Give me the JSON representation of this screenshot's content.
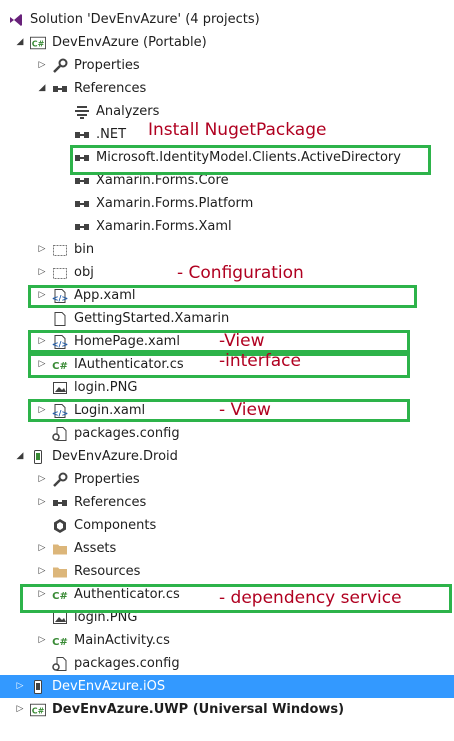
{
  "tree": {
    "items": [
      {
        "label": "Solution 'DevEnvAzure' (4 projects)",
        "icon": "vs-solution-icon",
        "arrow": ""
      },
      {
        "label": "DevEnvAzure (Portable)",
        "icon": "csharp-project-icon",
        "arrow": "expanded"
      },
      {
        "label": "Properties",
        "icon": "wrench-icon",
        "arrow": "collapsed"
      },
      {
        "label": "References",
        "icon": "references-icon",
        "arrow": "expanded"
      },
      {
        "label": "Analyzers",
        "icon": "analyzers-icon",
        "arrow": ""
      },
      {
        "label": ".NET",
        "icon": "reference-icon",
        "arrow": ""
      },
      {
        "label": "Microsoft.IdentityModel.Clients.ActiveDirectory",
        "icon": "reference-icon",
        "arrow": ""
      },
      {
        "label": "Xamarin.Forms.Core",
        "icon": "reference-icon",
        "arrow": ""
      },
      {
        "label": "Xamarin.Forms.Platform",
        "icon": "reference-icon",
        "arrow": ""
      },
      {
        "label": "Xamarin.Forms.Xaml",
        "icon": "reference-icon",
        "arrow": ""
      },
      {
        "label": "bin",
        "icon": "dashed-folder-icon",
        "arrow": "collapsed"
      },
      {
        "label": "obj",
        "icon": "dashed-folder-icon",
        "arrow": "collapsed"
      },
      {
        "label": "App.xaml",
        "icon": "xaml-file-icon",
        "arrow": "collapsed"
      },
      {
        "label": "GettingStarted.Xamarin",
        "icon": "file-icon",
        "arrow": ""
      },
      {
        "label": "HomePage.xaml",
        "icon": "xaml-file-icon",
        "arrow": "collapsed"
      },
      {
        "label": "IAuthenticator.cs",
        "icon": "csharp-file-icon",
        "arrow": "collapsed"
      },
      {
        "label": "login.PNG",
        "icon": "image-file-icon",
        "arrow": ""
      },
      {
        "label": "Login.xaml",
        "icon": "xaml-file-icon",
        "arrow": "collapsed"
      },
      {
        "label": "packages.config",
        "icon": "config-file-icon",
        "arrow": ""
      },
      {
        "label": "DevEnvAzure.Droid",
        "icon": "android-project-icon",
        "arrow": "expanded"
      },
      {
        "label": "Properties",
        "icon": "wrench-icon",
        "arrow": "collapsed"
      },
      {
        "label": "References",
        "icon": "references-icon",
        "arrow": "collapsed"
      },
      {
        "label": "Components",
        "icon": "components-icon",
        "arrow": ""
      },
      {
        "label": "Assets",
        "icon": "folder-icon",
        "arrow": "collapsed"
      },
      {
        "label": "Resources",
        "icon": "folder-icon",
        "arrow": "collapsed"
      },
      {
        "label": "Authenticator.cs",
        "icon": "csharp-file-icon",
        "arrow": "collapsed"
      },
      {
        "label": "login.PNG",
        "icon": "image-file-icon",
        "arrow": ""
      },
      {
        "label": "MainActivity.cs",
        "icon": "csharp-file-icon",
        "arrow": "collapsed"
      },
      {
        "label": "packages.config",
        "icon": "config-file-icon",
        "arrow": ""
      },
      {
        "label": "DevEnvAzure.iOS",
        "icon": "ios-project-icon",
        "arrow": "collapsed"
      },
      {
        "label": "DevEnvAzure.UWP (Universal Windows)",
        "icon": "csharp-project-icon",
        "arrow": "collapsed"
      }
    ],
    "selected_label": "DevEnvAzure.iOS"
  },
  "annotations": {
    "install": "Install NugetPackage",
    "configuration": "- Configuration",
    "view1": "-View",
    "interface": "-interface",
    "view2": "- View",
    "dependency": "- dependency service"
  },
  "colors": {
    "annotation_text": "#b00020",
    "annotation_box": "#2db34a",
    "selection": "#3399ff",
    "csharp_green": "#388a34",
    "xaml_blue": "#1e5aa8",
    "folder": "#dcb67a",
    "vs_purple": "#68217a"
  }
}
